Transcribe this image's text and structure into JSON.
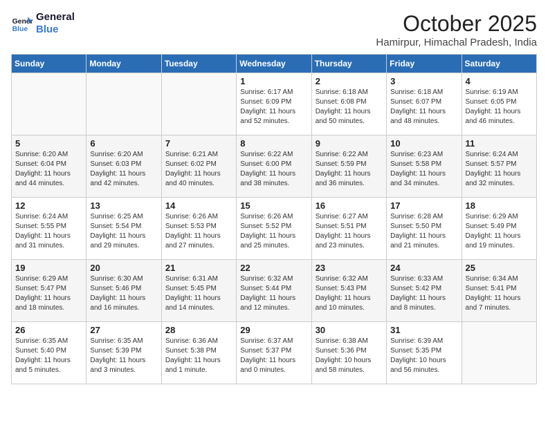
{
  "logo": {
    "line1": "General",
    "line2": "Blue"
  },
  "title": "October 2025",
  "location": "Hamirpur, Himachal Pradesh, India",
  "days_of_week": [
    "Sunday",
    "Monday",
    "Tuesday",
    "Wednesday",
    "Thursday",
    "Friday",
    "Saturday"
  ],
  "weeks": [
    [
      {
        "day": "",
        "info": ""
      },
      {
        "day": "",
        "info": ""
      },
      {
        "day": "",
        "info": ""
      },
      {
        "day": "1",
        "info": "Sunrise: 6:17 AM\nSunset: 6:09 PM\nDaylight: 11 hours\nand 52 minutes."
      },
      {
        "day": "2",
        "info": "Sunrise: 6:18 AM\nSunset: 6:08 PM\nDaylight: 11 hours\nand 50 minutes."
      },
      {
        "day": "3",
        "info": "Sunrise: 6:18 AM\nSunset: 6:07 PM\nDaylight: 11 hours\nand 48 minutes."
      },
      {
        "day": "4",
        "info": "Sunrise: 6:19 AM\nSunset: 6:05 PM\nDaylight: 11 hours\nand 46 minutes."
      }
    ],
    [
      {
        "day": "5",
        "info": "Sunrise: 6:20 AM\nSunset: 6:04 PM\nDaylight: 11 hours\nand 44 minutes."
      },
      {
        "day": "6",
        "info": "Sunrise: 6:20 AM\nSunset: 6:03 PM\nDaylight: 11 hours\nand 42 minutes."
      },
      {
        "day": "7",
        "info": "Sunrise: 6:21 AM\nSunset: 6:02 PM\nDaylight: 11 hours\nand 40 minutes."
      },
      {
        "day": "8",
        "info": "Sunrise: 6:22 AM\nSunset: 6:00 PM\nDaylight: 11 hours\nand 38 minutes."
      },
      {
        "day": "9",
        "info": "Sunrise: 6:22 AM\nSunset: 5:59 PM\nDaylight: 11 hours\nand 36 minutes."
      },
      {
        "day": "10",
        "info": "Sunrise: 6:23 AM\nSunset: 5:58 PM\nDaylight: 11 hours\nand 34 minutes."
      },
      {
        "day": "11",
        "info": "Sunrise: 6:24 AM\nSunset: 5:57 PM\nDaylight: 11 hours\nand 32 minutes."
      }
    ],
    [
      {
        "day": "12",
        "info": "Sunrise: 6:24 AM\nSunset: 5:55 PM\nDaylight: 11 hours\nand 31 minutes."
      },
      {
        "day": "13",
        "info": "Sunrise: 6:25 AM\nSunset: 5:54 PM\nDaylight: 11 hours\nand 29 minutes."
      },
      {
        "day": "14",
        "info": "Sunrise: 6:26 AM\nSunset: 5:53 PM\nDaylight: 11 hours\nand 27 minutes."
      },
      {
        "day": "15",
        "info": "Sunrise: 6:26 AM\nSunset: 5:52 PM\nDaylight: 11 hours\nand 25 minutes."
      },
      {
        "day": "16",
        "info": "Sunrise: 6:27 AM\nSunset: 5:51 PM\nDaylight: 11 hours\nand 23 minutes."
      },
      {
        "day": "17",
        "info": "Sunrise: 6:28 AM\nSunset: 5:50 PM\nDaylight: 11 hours\nand 21 minutes."
      },
      {
        "day": "18",
        "info": "Sunrise: 6:29 AM\nSunset: 5:49 PM\nDaylight: 11 hours\nand 19 minutes."
      }
    ],
    [
      {
        "day": "19",
        "info": "Sunrise: 6:29 AM\nSunset: 5:47 PM\nDaylight: 11 hours\nand 18 minutes."
      },
      {
        "day": "20",
        "info": "Sunrise: 6:30 AM\nSunset: 5:46 PM\nDaylight: 11 hours\nand 16 minutes."
      },
      {
        "day": "21",
        "info": "Sunrise: 6:31 AM\nSunset: 5:45 PM\nDaylight: 11 hours\nand 14 minutes."
      },
      {
        "day": "22",
        "info": "Sunrise: 6:32 AM\nSunset: 5:44 PM\nDaylight: 11 hours\nand 12 minutes."
      },
      {
        "day": "23",
        "info": "Sunrise: 6:32 AM\nSunset: 5:43 PM\nDaylight: 11 hours\nand 10 minutes."
      },
      {
        "day": "24",
        "info": "Sunrise: 6:33 AM\nSunset: 5:42 PM\nDaylight: 11 hours\nand 8 minutes."
      },
      {
        "day": "25",
        "info": "Sunrise: 6:34 AM\nSunset: 5:41 PM\nDaylight: 11 hours\nand 7 minutes."
      }
    ],
    [
      {
        "day": "26",
        "info": "Sunrise: 6:35 AM\nSunset: 5:40 PM\nDaylight: 11 hours\nand 5 minutes."
      },
      {
        "day": "27",
        "info": "Sunrise: 6:35 AM\nSunset: 5:39 PM\nDaylight: 11 hours\nand 3 minutes."
      },
      {
        "day": "28",
        "info": "Sunrise: 6:36 AM\nSunset: 5:38 PM\nDaylight: 11 hours\nand 1 minute."
      },
      {
        "day": "29",
        "info": "Sunrise: 6:37 AM\nSunset: 5:37 PM\nDaylight: 11 hours\nand 0 minutes."
      },
      {
        "day": "30",
        "info": "Sunrise: 6:38 AM\nSunset: 5:36 PM\nDaylight: 10 hours\nand 58 minutes."
      },
      {
        "day": "31",
        "info": "Sunrise: 6:39 AM\nSunset: 5:35 PM\nDaylight: 10 hours\nand 56 minutes."
      },
      {
        "day": "",
        "info": ""
      }
    ]
  ]
}
